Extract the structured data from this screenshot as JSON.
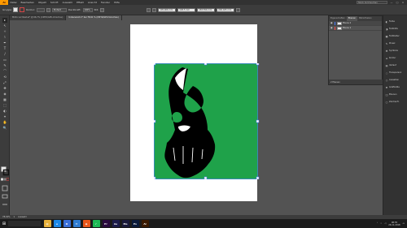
{
  "menubar": {
    "app_label": "Ai",
    "items": [
      "Datei",
      "Bearbeiten",
      "Objekt",
      "Schrift",
      "Auswahl",
      "Effekt",
      "Ansicht",
      "Fenster",
      "Hilfe"
    ],
    "search_placeholder": "Stock durchsuchen",
    "window_controls": [
      "—",
      "□",
      "×"
    ]
  },
  "controlbar": {
    "selection_label": "Gruppe",
    "fill_color": "#e8e8e8",
    "stroke_color": "#d64545",
    "stroke_label": "Kontur:",
    "style_field": "Einfach",
    "opacity_label": "Deckkraft:",
    "opacity_value": "100%",
    "style_label": "Stil:",
    "x_value": "105,906 mm",
    "y_value": "148,5 mm",
    "w_value": "183,556 mm",
    "h_value": "200,025 mm"
  },
  "doc_tabs": [
    {
      "label": "Motiv vor Rest.ai* @ 66,7% (CMYK/GPU-Vorschau)",
      "active": false
    },
    {
      "label": "Unbenannt-1* bei 78,91 % (CMYK/GPU-Vorschau)",
      "active": true
    }
  ],
  "tools": [
    "▸",
    "↖",
    "✧",
    "⌇",
    "✒",
    "T",
    "/",
    "▭",
    "✎",
    "⌒",
    "⟲",
    "⤢",
    "✥",
    "◈",
    "▦",
    "⬚",
    "◐",
    "⌖",
    "✋",
    "🔍"
  ],
  "layers_panel": {
    "tabs": [
      "Eigenschaften",
      "Ebenen",
      "Bibliotheken"
    ],
    "active_tab": "Ebenen",
    "layers": [
      {
        "name": "Ebene 2",
        "color": "#4a7bff",
        "selected": true
      },
      {
        "name": "Ebene 1",
        "color": "#ff4a4a",
        "selected": false
      }
    ],
    "footer": "2 Ebenen"
  },
  "dock": {
    "items": [
      {
        "label": "Farbe",
        "icon": "palette-icon"
      },
      {
        "label": "Farbhilfe",
        "icon": "color-guide-icon"
      },
      {
        "label": "Farbfelder",
        "icon": "swatches-icon"
      },
      {
        "label": "Pinsel",
        "icon": "brush-icon"
      },
      {
        "label": "Symbole",
        "icon": "symbols-icon"
      },
      {
        "label": "Kontur",
        "icon": "stroke-icon"
      },
      {
        "label": "Verlauf",
        "icon": "gradient-icon"
      },
      {
        "label": "Transparenz",
        "icon": "transparency-icon"
      },
      {
        "label": "Aussehen",
        "icon": "appearance-icon"
      },
      {
        "label": "Grafikstile",
        "icon": "graphic-styles-icon"
      },
      {
        "label": "Ebenen",
        "icon": "layers-icon"
      },
      {
        "label": "Zeichenfl.",
        "icon": "artboards-icon"
      }
    ]
  },
  "statusbar": {
    "zoom": "78,91%",
    "page": "1",
    "tool": "Auswahl"
  },
  "taskbar": {
    "apps": [
      {
        "name": "file-explorer",
        "color": "#e8b13b",
        "glyph": "▤"
      },
      {
        "name": "edge",
        "color": "#1e88e5",
        "glyph": "e"
      },
      {
        "name": "store",
        "color": "#3a6fd8",
        "glyph": "⊞"
      },
      {
        "name": "mail",
        "color": "#2e7bd1",
        "glyph": "✉"
      },
      {
        "name": "firefox",
        "color": "#e8561a",
        "glyph": "◉"
      },
      {
        "name": "spotify",
        "color": "#1db954",
        "glyph": "♪"
      },
      {
        "name": "premiere",
        "color": "#2a0a3e",
        "glyph": "Pr"
      },
      {
        "name": "after-effects",
        "color": "#1c1c4a",
        "glyph": "Ae"
      },
      {
        "name": "media-encoder",
        "color": "#1a1a3a",
        "glyph": "Me"
      },
      {
        "name": "photoshop",
        "color": "#0a1a3a",
        "glyph": "Ps"
      },
      {
        "name": "illustrator",
        "color": "#3a1a00",
        "glyph": "Ai"
      }
    ],
    "time": "08:35",
    "date": "26.11.2018"
  },
  "artwork": {
    "background_color": "#1fa24a",
    "art_color": "#000000"
  }
}
